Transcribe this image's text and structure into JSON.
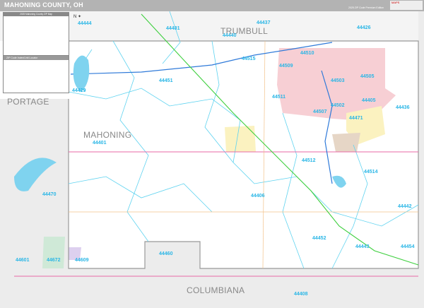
{
  "header": {
    "title": "MAHONING COUNTY, OH",
    "edition": "2025 ZIP Code Premium Edition",
    "logo": "MAPS"
  },
  "legend": {
    "title": "2025 Mahoning County ZIP Map"
  },
  "index": {
    "title": "ZIP Code Index/Unit Locator"
  },
  "compass": {
    "north": "N"
  },
  "counties": [
    "TRUMBULL",
    "PORTAGE",
    "MAHONING",
    "COLUMBIANA"
  ],
  "zips": [
    "44444",
    "44481",
    "44440",
    "44437",
    "44426",
    "44515",
    "44451",
    "44429",
    "44510",
    "44509",
    "44505",
    "44503",
    "44511",
    "44502",
    "44507",
    "44405",
    "44436",
    "44471",
    "44401",
    "44512",
    "44514",
    "44470",
    "44406",
    "44442",
    "44452",
    "44443",
    "44454",
    "44460",
    "44601",
    "44672",
    "44609",
    "44408"
  ],
  "colors": {
    "header": "#b3b3b3",
    "zip_label": "#29b6e6",
    "urban": "#f7cfd4",
    "outside": "#ececec",
    "interstate": "#2f7ad9",
    "turnpike": "#3ecf3e"
  }
}
